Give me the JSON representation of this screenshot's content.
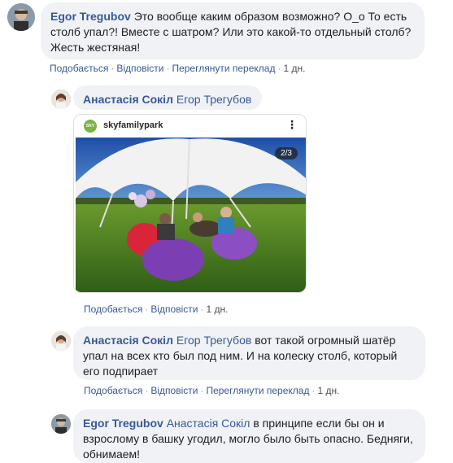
{
  "comments": [
    {
      "author": "Egor Tregubov",
      "text": "Это вообще каким образом возможно? О_о То есть столб упал?! Вместе с шатром? Или это какой-то отдельный столб? Жесть жестяная!",
      "actions": [
        "Подобається",
        "Відповісти",
        "Переглянути переклад"
      ],
      "time": "1 дн."
    },
    {
      "author": "Анастасія Сокіл",
      "mention": "Егор Трегубов",
      "text": "",
      "actions": [
        "Подобається",
        "Відповісти"
      ],
      "time": "1 дн.",
      "attachment": {
        "account": "skyfamilypark",
        "logo_text": "SKY FAMILY PARK",
        "more_icon": "more-vertical-icon",
        "counter": "2/3"
      }
    },
    {
      "author": "Анастасія Сокіл",
      "mention": "Егор Трегубов",
      "text": "вот такой огромный шатёр упал на всех кто был под ним. И на колеску столб, который его подпирает",
      "actions": [
        "Подобається",
        "Відповісти",
        "Переглянути переклад"
      ],
      "time": "1 дн."
    },
    {
      "author": "Egor Tregubov",
      "mention": "Анастасія Сокіл",
      "text": "в принципе если бы он и взрослому в башку угодил, могло было быть опасно. Бедняги, обнимаем!",
      "actions": [],
      "time": ""
    }
  ],
  "colors": {
    "link": "#385898",
    "bubble": "#f0f2f5",
    "meta": "#4b4f56"
  }
}
